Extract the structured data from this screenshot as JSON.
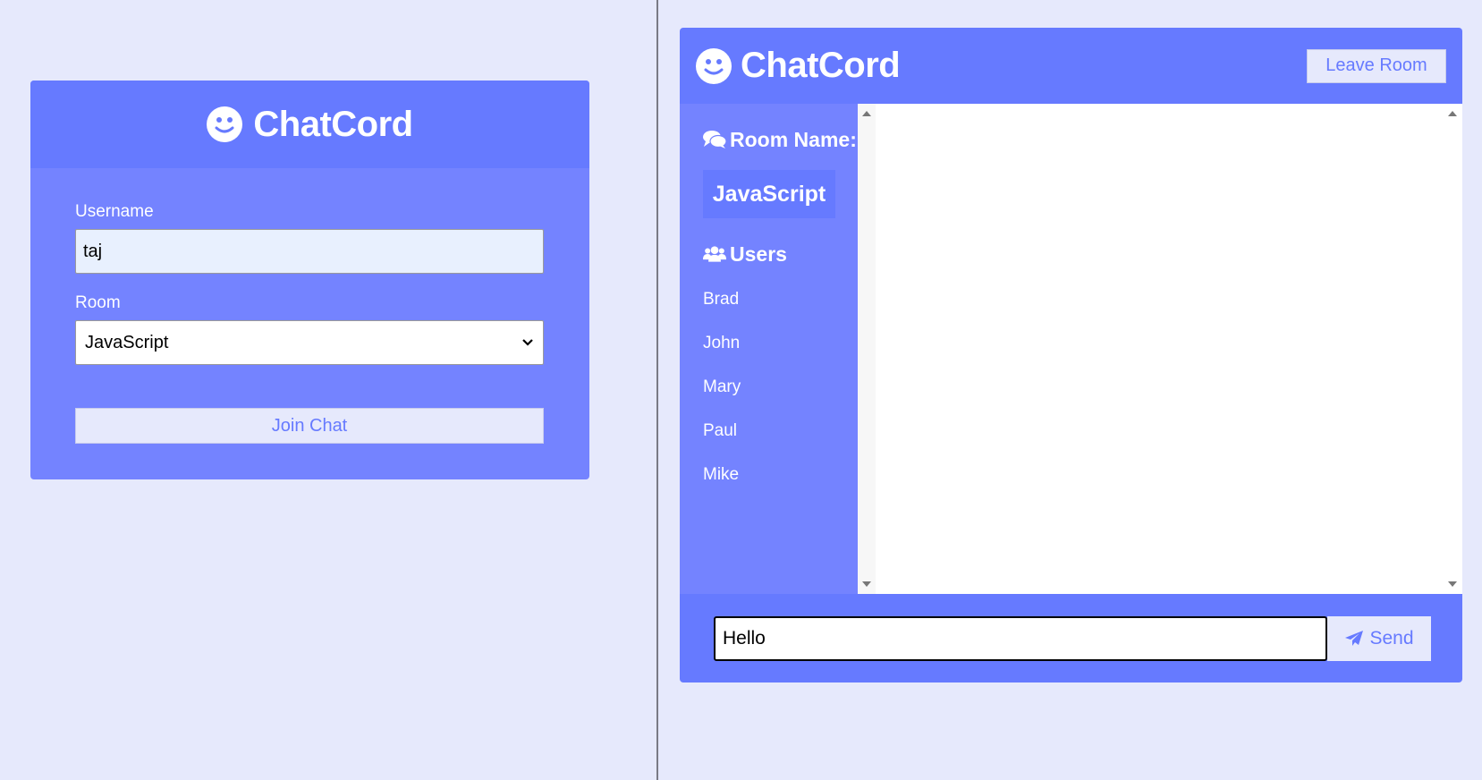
{
  "colors": {
    "page_bg": "#e6e9fc",
    "primary": "#667aff",
    "secondary": "#7483ff",
    "button_bg": "#e6e9fc",
    "text_light": "#ffffff"
  },
  "join": {
    "brand": "ChatCord",
    "brand_icon": "smile-icon",
    "username_label": "Username",
    "username_value": "taj",
    "room_label": "Room",
    "room_selected": "JavaScript",
    "join_button": "Join Chat"
  },
  "chat": {
    "brand": "ChatCord",
    "brand_icon": "smile-icon",
    "leave_button": "Leave Room",
    "room_heading": "Room Name:",
    "room_icon": "comments-icon",
    "room_name": "JavaScript",
    "users_heading": "Users",
    "users_icon": "users-icon",
    "users": [
      "Brad",
      "John",
      "Mary",
      "Paul",
      "Mike"
    ],
    "message_value": "Hello",
    "send_button": "Send",
    "send_icon": "paper-plane-icon"
  }
}
